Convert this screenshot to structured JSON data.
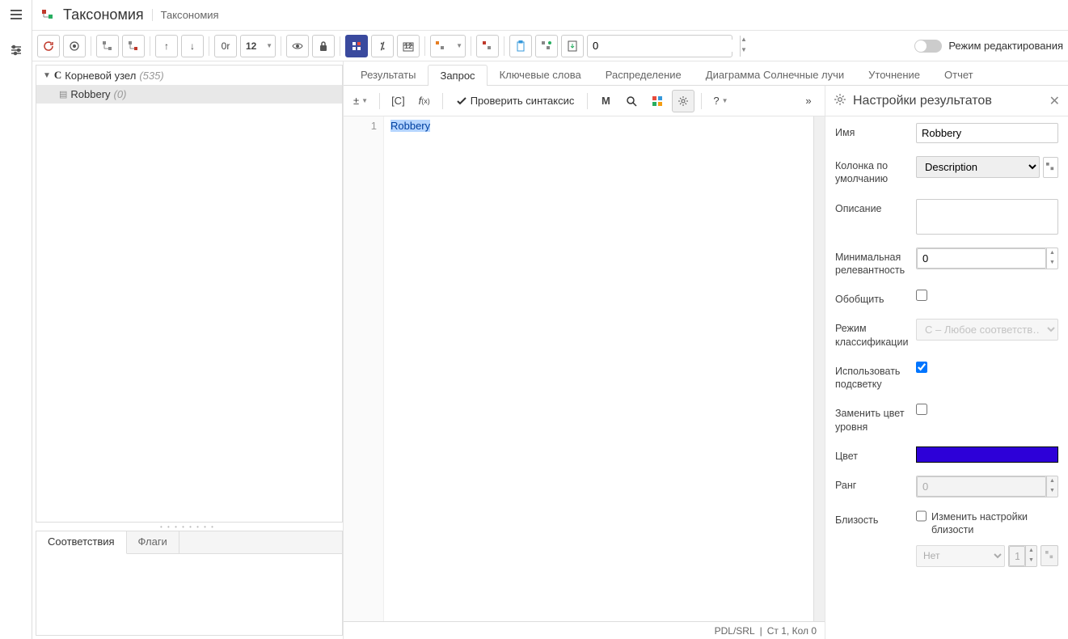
{
  "header": {
    "app_title": "Таксономия",
    "breadcrumb": "Таксономия"
  },
  "toolbar": {
    "refresh": "↻",
    "target": "◎",
    "or_label": "0r",
    "number": "12",
    "num_input": "0",
    "toggle_label": "Режим редактирования"
  },
  "tree": {
    "root_label": "Корневой узел",
    "root_count": "(535)",
    "child_label": "Robbery",
    "child_count": "(0)"
  },
  "bottom_tabs": {
    "matches": "Соответствия",
    "flags": "Флаги"
  },
  "tabs": {
    "results": "Результаты",
    "query": "Запрос",
    "keywords": "Ключевые слова",
    "distribution": "Распределение",
    "sunburst": "Диаграмма Солнечные лучи",
    "refine": "Уточнение",
    "report": "Отчет"
  },
  "editor_toolbar": {
    "pm": "±",
    "c": "[C]",
    "fx": "f(x)",
    "check_syntax": "Проверить синтаксис",
    "m": "M",
    "help": "?"
  },
  "code": {
    "line1_num": "1",
    "line1_text": "Robbery"
  },
  "status": {
    "lang": "PDL/SRL",
    "pos": "Ст 1, Кол 0"
  },
  "props": {
    "title": "Настройки результатов",
    "name_label": "Имя",
    "name_value": "Robbery",
    "defcol_label": "Колонка по умолчанию",
    "defcol_value": "Description",
    "desc_label": "Описание",
    "desc_value": "",
    "minrel_label": "Минимальная релевантность",
    "minrel_value": "0",
    "generalize_label": "Обобщить",
    "classmode_label": "Режим классификации",
    "classmode_value": "C – Любое соответств…",
    "highlight_label": "Использовать подсветку",
    "replace_color_label": "Заменить цвет уровня",
    "color_label": "Цвет",
    "color_value": "#2d00d8",
    "rank_label": "Ранг",
    "rank_value": "0",
    "proximity_label": "Близость",
    "prox_check_label": "Изменить настройки близости",
    "prox_select": "Нет",
    "prox_num": "1"
  }
}
